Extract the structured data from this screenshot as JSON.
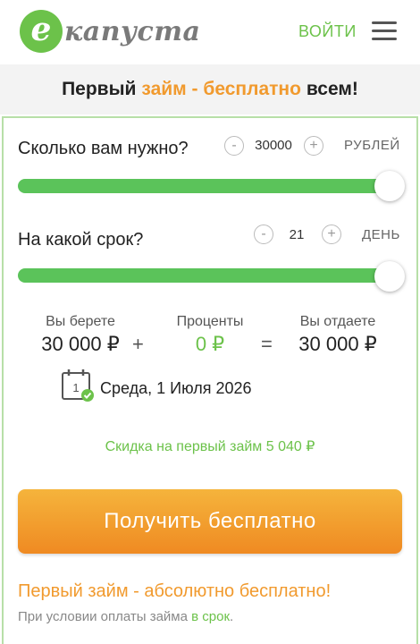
{
  "header": {
    "logo_letter": "e",
    "logo_text": "капуста",
    "login_label": "ВОЙТИ"
  },
  "banner": {
    "part1": "Первый",
    "part2": "займ - бесплатно",
    "part3": "всем!"
  },
  "amount": {
    "question": "Сколько вам нужно?",
    "minus": "-",
    "value": "30000",
    "plus": "+",
    "unit": "РУБЛЕЙ",
    "slider_fraction": 1.0
  },
  "term": {
    "question": "На какой срок?",
    "minus": "-",
    "value": "21",
    "plus": "+",
    "unit": "ДЕНЬ",
    "slider_fraction": 1.0
  },
  "summary": {
    "take_label": "Вы берете",
    "take_value": "30 000 ₽",
    "plus_sign": "+",
    "interest_label": "Проценты",
    "interest_value": "0 ₽",
    "equals_sign": "=",
    "return_label": "Вы отдаете",
    "return_value": "30 000 ₽"
  },
  "calendar": {
    "day_number": "1",
    "date": "Среда, 1 Июля 2026"
  },
  "discount": "Скидка на первый займ 5 040 ₽",
  "cta_label": "Получить бесплатно",
  "footer": {
    "title": "Первый займ - абсолютно бесплатно!",
    "note_prefix": "При условии оплаты займа",
    "note_link": "в срок",
    "note_suffix": "."
  },
  "colors": {
    "brand_green": "#6cc24a",
    "slider_green": "#5bc35a",
    "accent_orange": "#f19a2e"
  }
}
